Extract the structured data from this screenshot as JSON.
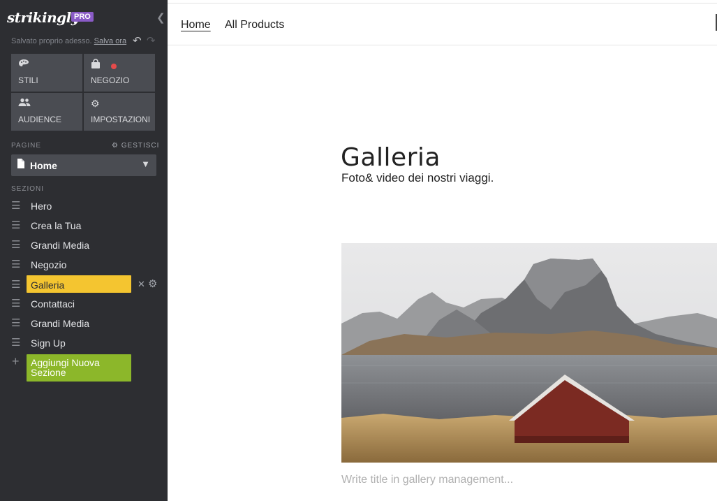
{
  "sidebar": {
    "brand": "strikingly",
    "badge": "PRO",
    "saved_text": "Salvato proprio adesso.",
    "save_now": "Salva ora",
    "tiles": [
      {
        "label": "STILI",
        "icon": "palette-icon"
      },
      {
        "label": "NEGOZIO",
        "icon": "shopping-bag-icon"
      },
      {
        "label": "AUDIENCE",
        "icon": "people-icon"
      },
      {
        "label": "IMPOSTAZIONI",
        "icon": "gear-icon"
      }
    ],
    "pages_title": "PAGINE",
    "manage_label": "GESTISCI",
    "current_page": "Home",
    "sections_title": "SEZIONI",
    "sections": [
      "Hero",
      "Crea la Tua",
      "Grandi Media",
      "Negozio",
      "Galleria",
      "Contattaci",
      "Grandi Media",
      "Sign Up"
    ],
    "active_section": "Galleria",
    "add_section": "Aggiungi Nuova Sezione"
  },
  "topnav": {
    "items": [
      "Home",
      "All Products"
    ],
    "active": "Home"
  },
  "content": {
    "heading": "Galleria",
    "subheading": "Foto& video dei nostri viaggi.",
    "gallery_placeholder": "Write title in gallery management..."
  },
  "colors": {
    "sidebar_bg": "#2d2e32",
    "tile_bg": "#4a4c52",
    "active_section": "#f4c530",
    "add_section": "#8cb72a",
    "pro_badge": "#8a5bc7",
    "notification_dot": "#e54b4b"
  }
}
